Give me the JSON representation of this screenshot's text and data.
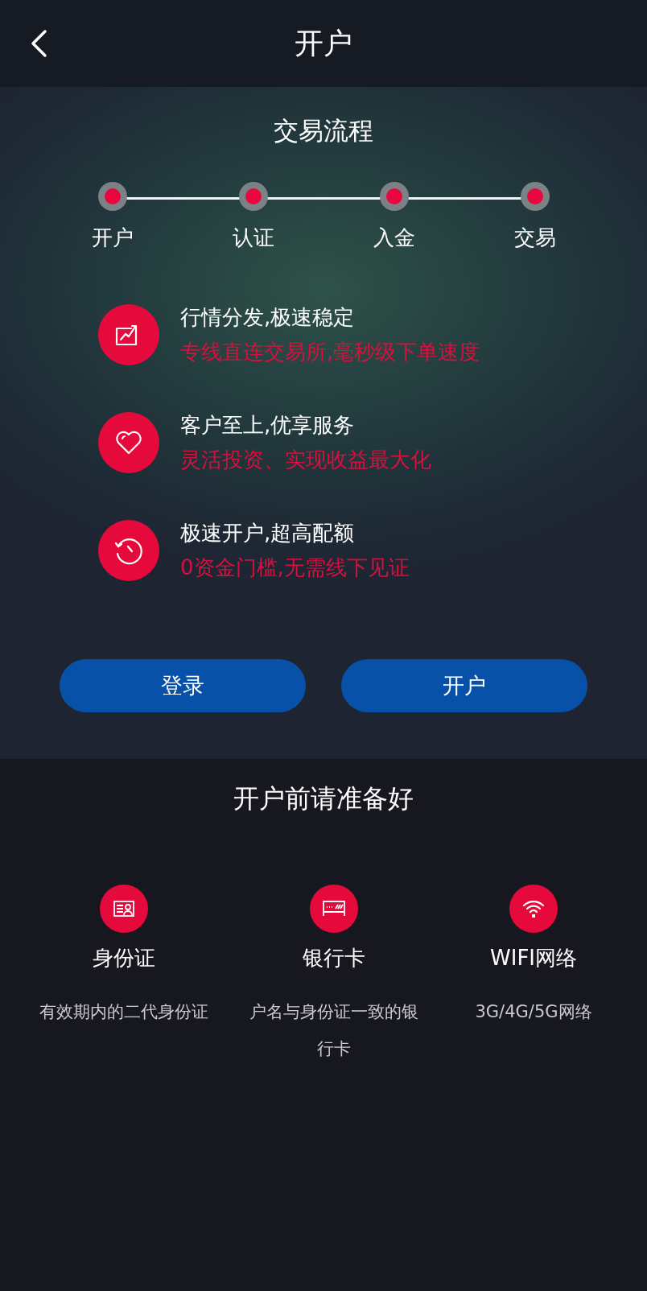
{
  "header": {
    "title": "开户"
  },
  "process": {
    "title": "交易流程",
    "steps": [
      {
        "label": "开户"
      },
      {
        "label": "认证"
      },
      {
        "label": "入金"
      },
      {
        "label": "交易"
      }
    ]
  },
  "features": [
    {
      "kind": "chart",
      "title": "行情分发,极速稳定",
      "subtitle": "专线直连交易所,毫秒级下单速度"
    },
    {
      "kind": "heart",
      "title": "客户至上,优享服务",
      "subtitle": "灵活投资、实现收益最大化"
    },
    {
      "kind": "clock",
      "title": "极速开户,超高配额",
      "subtitle": "0资金门槛,无需线下见证"
    }
  ],
  "buttons": [
    {
      "label": "登录"
    },
    {
      "label": "开户"
    }
  ],
  "prepare": {
    "title": "开户前请准备好",
    "items": [
      {
        "kind": "id",
        "title": "身份证",
        "desc": "有效期内的二代身份证"
      },
      {
        "kind": "card",
        "title": "银行卡",
        "desc": "户名与身份证一致的银行卡"
      },
      {
        "kind": "wifi",
        "title": "WIFI网络",
        "desc": "3G/4G/5G网络"
      }
    ]
  }
}
